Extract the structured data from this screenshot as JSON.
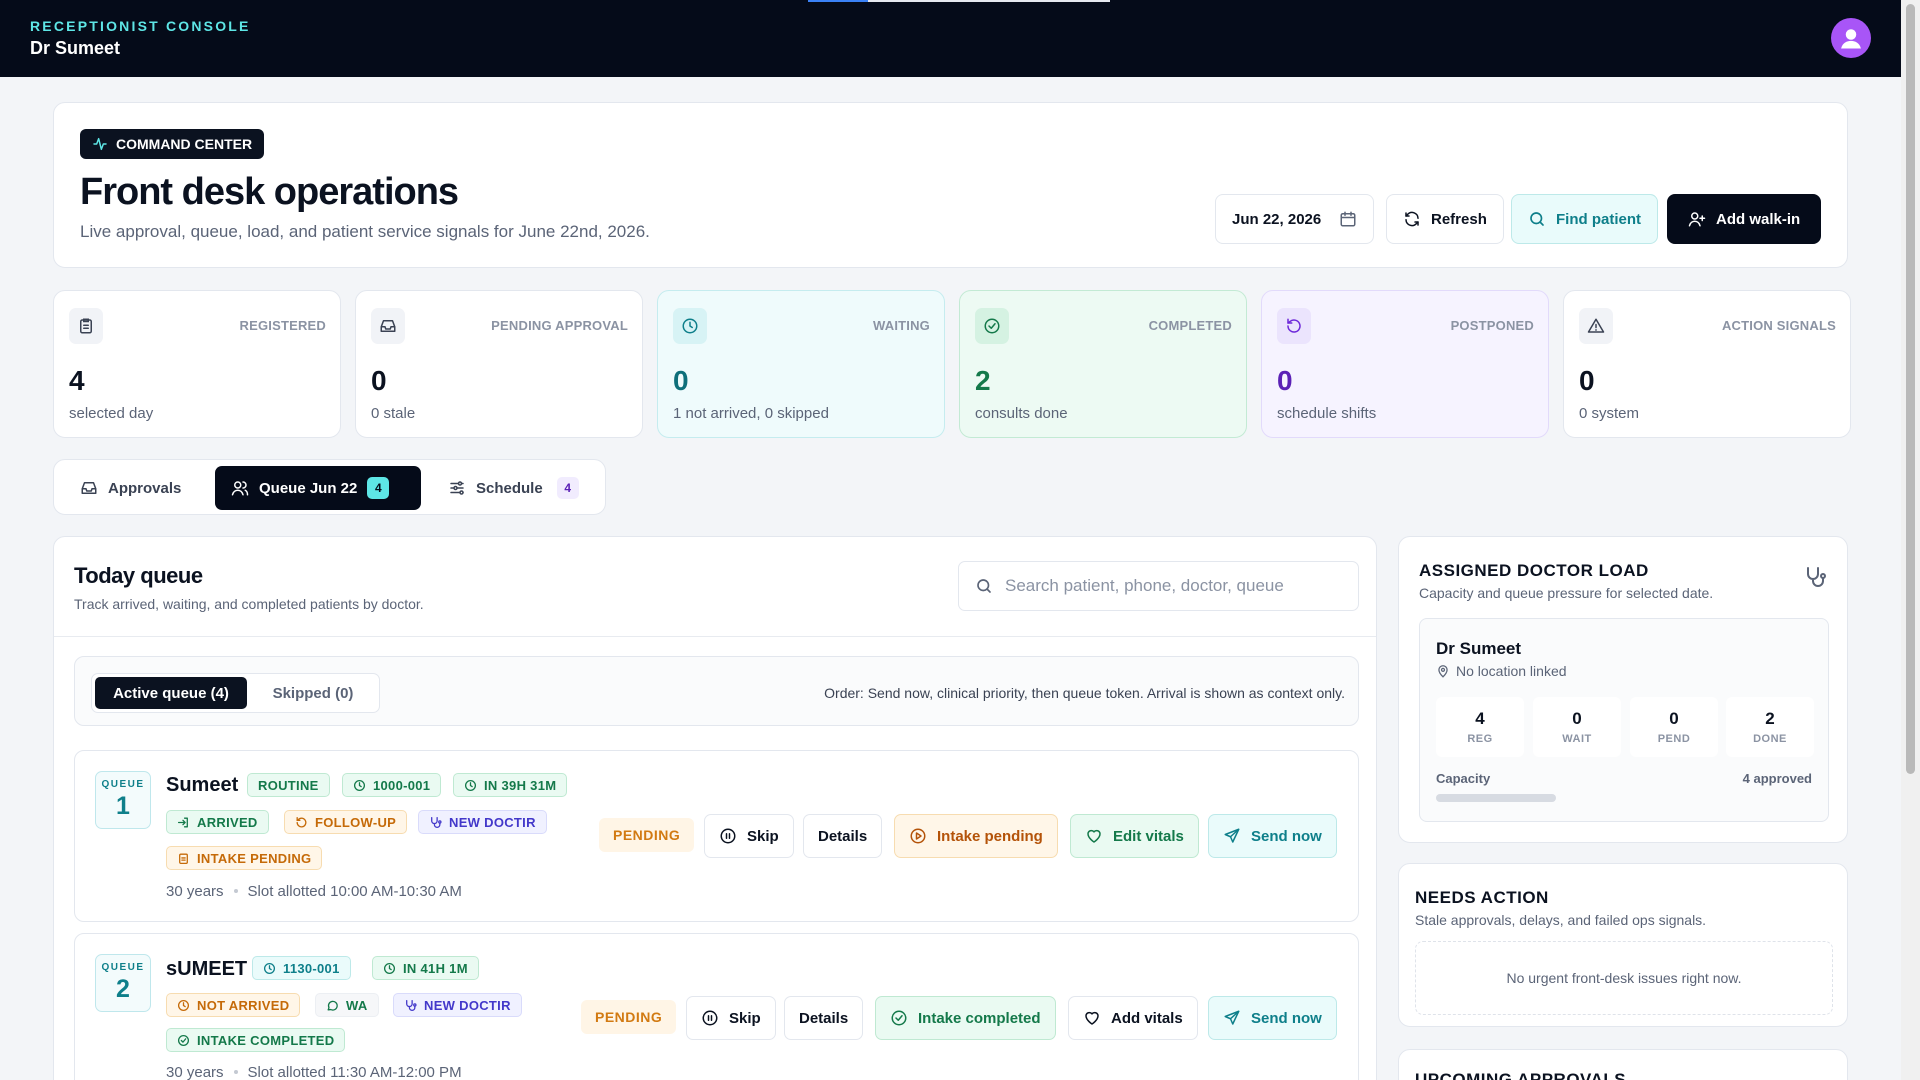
{
  "topbar": {
    "console_label": "RECEPTIONIST CONSOLE",
    "doctor_name": "Dr Sumeet"
  },
  "hero": {
    "badge": "COMMAND CENTER",
    "title": "Front desk operations",
    "subtitle": "Live approval, queue, load, and patient service signals for June 22nd, 2026.",
    "date": "Jun 22, 2026",
    "refresh": "Refresh",
    "find_patient": "Find patient",
    "add_walkin": "Add walk-in"
  },
  "stats": [
    {
      "label": "REGISTERED",
      "value": "4",
      "note": "selected day",
      "icon": "clipboard-icon",
      "bg": "#ffffff",
      "border": "#e3e7ee",
      "color": "#0b1220",
      "icon_bg": "#f1f3f7"
    },
    {
      "label": "PENDING APPROVAL",
      "value": "0",
      "note": "0 stale",
      "icon": "inbox-icon",
      "bg": "#ffffff",
      "border": "#e3e7ee",
      "color": "#0b1220",
      "icon_bg": "#f1f3f7"
    },
    {
      "label": "WAITING",
      "value": "0",
      "note": "1 not arrived, 0 skipped",
      "icon": "clock-icon",
      "bg": "#effbfc",
      "border": "#c5ecef",
      "color": "#0e6f7a",
      "icon_bg": "#d7f3f5"
    },
    {
      "label": "COMPLETED",
      "value": "2",
      "note": "consults done",
      "icon": "check-circle-icon",
      "bg": "#edfaf3",
      "border": "#c3ead4",
      "color": "#14794a",
      "icon_bg": "#d5f2e2"
    },
    {
      "label": "POSTPONED",
      "value": "0",
      "note": "schedule shifts",
      "icon": "rotate-icon",
      "bg": "#f6f3ff",
      "border": "#e2dafb",
      "color": "#5b21b6",
      "icon_bg": "#ebe4fd"
    },
    {
      "label": "ACTION SIGNALS",
      "value": "0",
      "note": "0 system",
      "icon": "alert-triangle-icon",
      "bg": "#ffffff",
      "border": "#e3e7ee",
      "color": "#0b1220",
      "icon_bg": "#f1f3f7"
    }
  ],
  "tabs": [
    {
      "label": "Approvals",
      "count": ""
    },
    {
      "label": "Queue Jun 22",
      "count": "4"
    },
    {
      "label": "Schedule",
      "count": "4"
    }
  ],
  "queue": {
    "title": "Today queue",
    "subtitle": "Track arrived, waiting, and completed patients by doctor.",
    "search_placeholder": "Search patient, phone, doctor, queue",
    "active_tab": "Active queue (4)",
    "skipped_tab": "Skipped (0)",
    "order_info": "Order: Send now, clinical priority, then queue token. Arrival is shown as context only.",
    "queue_label": "QUEUE",
    "rows": [
      {
        "number": "1",
        "name": "Sumeet",
        "priority": "ROUTINE",
        "token": "1000-001",
        "eta": "IN 39H 31M",
        "arrival": "ARRIVED",
        "visit_type": "FOLLOW-UP",
        "doctor": "NEW DOCTIR",
        "intake": "INTAKE PENDING",
        "age": "30 years",
        "slot": "Slot allotted 10:00 AM-10:30 AM",
        "status": "PENDING",
        "skip": "Skip",
        "details": "Details",
        "intake_btn": "Intake pending",
        "vitals_btn": "Edit vitals",
        "send_btn": "Send now"
      },
      {
        "number": "2",
        "name": "sUMEET",
        "priority": "",
        "token": "1130-001",
        "eta": "IN 41H 1M",
        "arrival": "NOT ARRIVED",
        "visit_type": "WA",
        "doctor": "NEW DOCTIR",
        "intake": "INTAKE COMPLETED",
        "age": "30 years",
        "slot": "Slot allotted 11:30 AM-12:00 PM",
        "status": "PENDING",
        "skip": "Skip",
        "details": "Details",
        "intake_btn": "Intake completed",
        "vitals_btn": "Add vitals",
        "send_btn": "Send now"
      }
    ]
  },
  "doctor_load": {
    "title": "ASSIGNED DOCTOR LOAD",
    "subtitle": "Capacity and queue pressure for selected date.",
    "doctor": "Dr Sumeet",
    "location": "No location linked",
    "metrics": [
      {
        "value": "4",
        "label": "REG"
      },
      {
        "value": "0",
        "label": "WAIT"
      },
      {
        "value": "0",
        "label": "PEND"
      },
      {
        "value": "2",
        "label": "DONE"
      }
    ],
    "capacity_label": "Capacity",
    "capacity_value": "4 approved"
  },
  "needs_action": {
    "title": "NEEDS ACTION",
    "subtitle": "Stale approvals, delays, and failed ops signals.",
    "empty": "No urgent front-desk issues right now."
  },
  "upcoming": {
    "title": "UPCOMING APPROVALS"
  }
}
